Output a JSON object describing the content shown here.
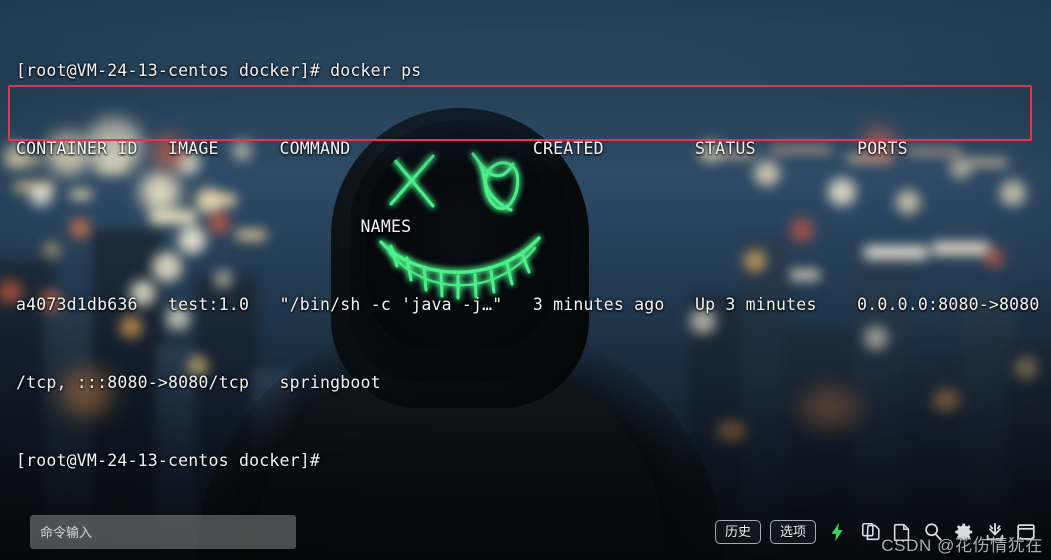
{
  "terminal": {
    "prompt_line_1": "[root@VM-24-13-centos docker]# docker ps",
    "header_line": "CONTAINER ID   IMAGE      COMMAND                  CREATED         STATUS          PORTS",
    "header_line_2": "                                  NAMES",
    "row_line_1": "a4073d1db636   test:1.0   \"/bin/sh -c 'java -j…\"   3 minutes ago   Up 3 minutes    0.0.0.0:8080->8080",
    "row_line_2": "/tcp, :::8080->8080/tcp   springboot",
    "prompt_line_2": "[root@VM-24-13-centos docker]#",
    "columns": [
      "CONTAINER ID",
      "IMAGE",
      "COMMAND",
      "CREATED",
      "STATUS",
      "PORTS",
      "NAMES"
    ],
    "container": {
      "container_id": "a4073d1db636",
      "image": "test:1.0",
      "command": "\"/bin/sh -c 'java -j…\"",
      "created": "3 minutes ago",
      "status": "Up 3 minutes",
      "ports": "0.0.0.0:8080->8080/tcp, :::8080->8080/tcp",
      "names": "springboot"
    },
    "highlight_color": "#e8334a"
  },
  "bottom_bar": {
    "command_input_placeholder": "命令输入",
    "command_input_value": "",
    "history_button": "历史",
    "options_button": "选项",
    "icons": [
      "lightning-bolt-icon",
      "copy-icon",
      "paste-icon",
      "search-icon",
      "gear-icon",
      "download-icon",
      "window-icon"
    ]
  },
  "watermark": "CSDN @花伤情犹在"
}
